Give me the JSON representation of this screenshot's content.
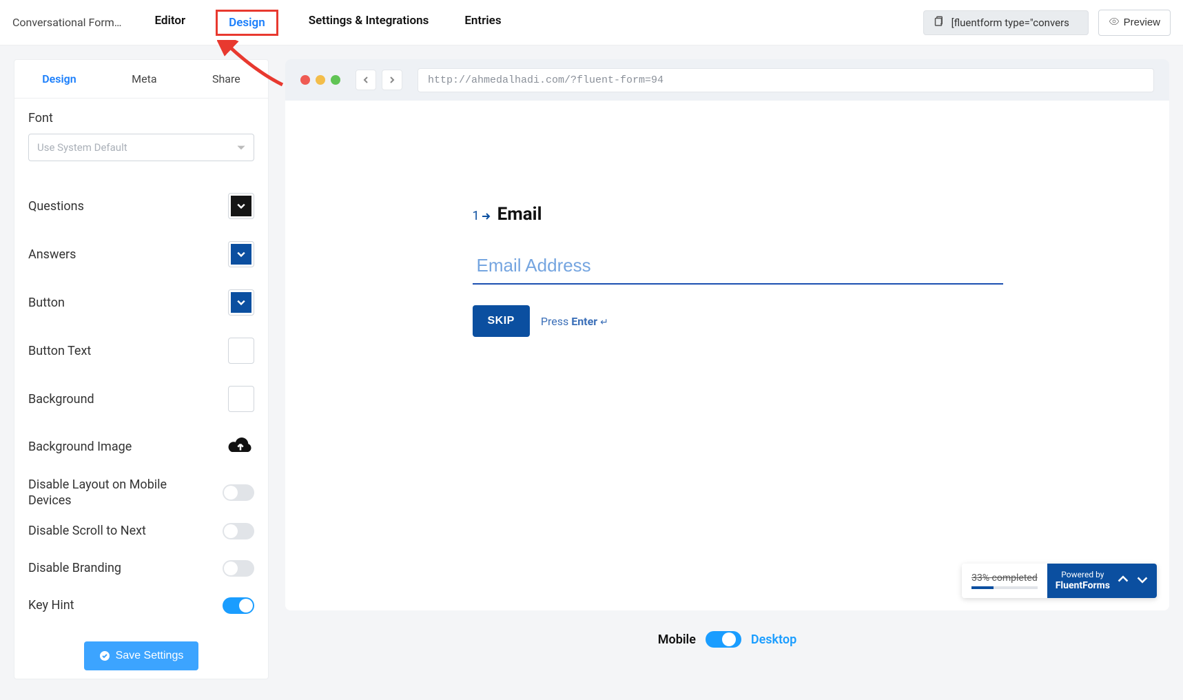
{
  "topbar": {
    "title": "Conversational Form…",
    "tabs": {
      "editor": "Editor",
      "design": "Design",
      "settings": "Settings & Integrations",
      "entries": "Entries"
    },
    "shortcode": "[fluentform type=\"convers",
    "preview_label": "Preview"
  },
  "sidebar": {
    "tabs": {
      "design": "Design",
      "meta": "Meta",
      "share": "Share"
    },
    "font_label": "Font",
    "font_select_placeholder": "Use System Default",
    "rows": {
      "questions": "Questions",
      "answers": "Answers",
      "button": "Button",
      "button_text": "Button Text",
      "background": "Background",
      "bg_image": "Background Image",
      "disable_mobile": "Disable Layout on Mobile Devices",
      "disable_scroll": "Disable Scroll to Next",
      "disable_branding": "Disable Branding",
      "key_hint": "Key Hint"
    },
    "colors": {
      "questions": "#151515",
      "answers": "#0b4fa0",
      "button": "#0b4fa0",
      "button_text": "#ffffff",
      "background": "#ffffff"
    },
    "toggles": {
      "disable_mobile": false,
      "disable_scroll": false,
      "disable_branding": false,
      "key_hint": true
    },
    "save_label": "Save Settings"
  },
  "preview": {
    "url": "http://ahmedalhadi.com/?fluent-form=94",
    "question_number": "1",
    "question_label": "Email",
    "input_placeholder": "Email Address",
    "skip_label": "SKIP",
    "press_label": "Press ",
    "enter_label": "Enter",
    "progress_text": "33% completed",
    "progress_pct": 33,
    "powered_small": "Powered by",
    "powered_brand": "FluentForms"
  },
  "device_switch": {
    "mobile": "Mobile",
    "desktop": "Desktop",
    "is_desktop": true
  }
}
